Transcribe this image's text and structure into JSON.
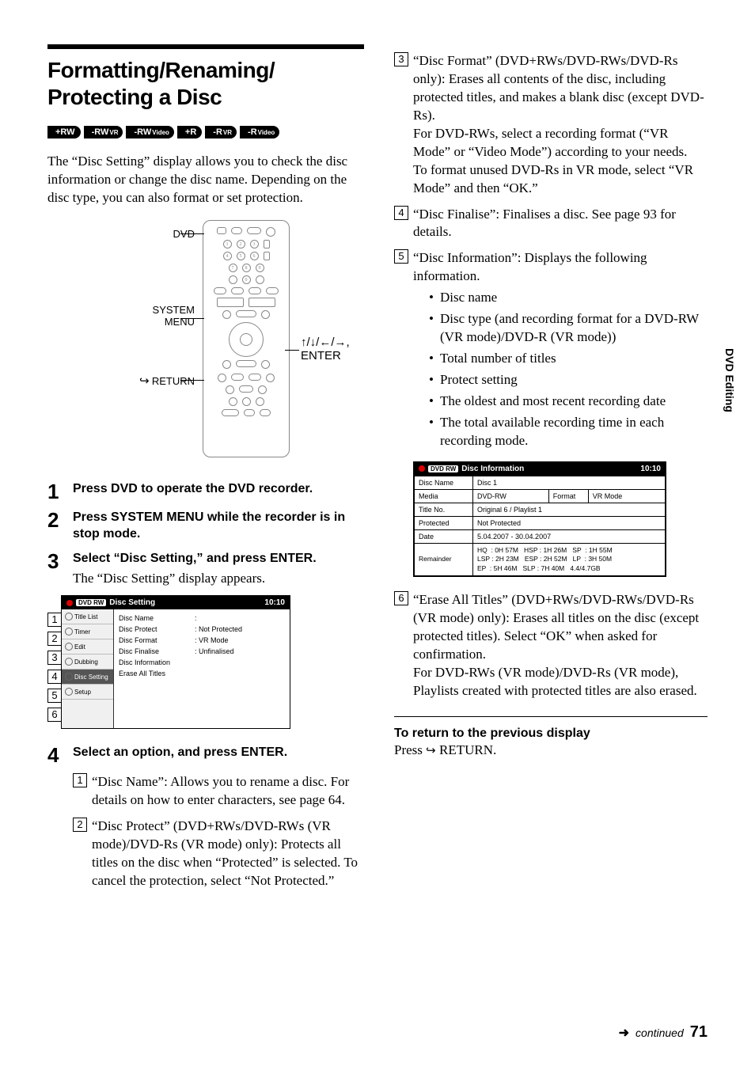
{
  "header": {
    "title_l1": "Formatting/Renaming/",
    "title_l2": "Protecting a Disc"
  },
  "disc_tags": [
    {
      "main": "+RW",
      "sub": ""
    },
    {
      "main": "-RW",
      "sub": "VR"
    },
    {
      "main": "-RW",
      "sub": "Video"
    },
    {
      "main": "+R",
      "sub": ""
    },
    {
      "main": "-R",
      "sub": "VR"
    },
    {
      "main": "-R",
      "sub": "Video"
    }
  ],
  "intro": "The “Disc Setting” display allows you to check the disc information or change the disc name. Depending on the disc type, you can also format or set protection.",
  "remote_labels": {
    "dvd": "DVD",
    "system_menu_l1": "SYSTEM",
    "system_menu_l2": "MENU",
    "return": "RETURN",
    "arrows_enter_l1": "↑/↓/←/→,",
    "arrows_enter_l2": "ENTER"
  },
  "steps": [
    {
      "n": "1",
      "bold": "Press DVD to operate the DVD recorder.",
      "plain": ""
    },
    {
      "n": "2",
      "bold": "Press SYSTEM MENU while the recorder is in stop mode.",
      "plain": ""
    },
    {
      "n": "3",
      "bold": "Select “Disc Setting,” and press ENTER.",
      "plain": "The “Disc Setting” display appears."
    },
    {
      "n": "4",
      "bold": "Select an option, and press ENTER.",
      "plain": ""
    }
  ],
  "disc_setting_ui": {
    "title": "Disc Setting",
    "clock": "10:10",
    "badge": "DVD RW",
    "side_tabs": [
      "Title List",
      "Timer",
      "Edit",
      "Dubbing",
      "Disc Setting",
      "Setup"
    ],
    "options": [
      {
        "name": "Disc Name",
        "value": ":"
      },
      {
        "name": "Disc Protect",
        "value": ": Not Protected"
      },
      {
        "name": "Disc Format",
        "value": ": VR Mode"
      },
      {
        "name": "Disc Finalise",
        "value": ": Unfinalised"
      },
      {
        "name": "Disc Information",
        "value": ""
      },
      {
        "name": "Erase All Titles",
        "value": ""
      }
    ]
  },
  "opts_left": [
    {
      "n": "1",
      "text": "“Disc Name”: Allows you to rename a disc. For details on how to enter characters, see page 64."
    },
    {
      "n": "2",
      "text": "“Disc Protect” (DVD+RWs/DVD-RWs (VR mode)/DVD-Rs (VR mode) only): Protects all titles on the disc when “Protected” is selected. To cancel the protection, select “Not Protected.”"
    }
  ],
  "opts_right": [
    {
      "n": "3",
      "text": "“Disc Format” (DVD+RWs/DVD-RWs/DVD-Rs only): Erases all contents of the disc, including protected titles, and makes a blank disc (except DVD-Rs).\nFor DVD-RWs, select a recording format (“VR Mode” or “Video Mode”) according to your needs.\nTo format unused DVD-Rs in VR mode, select “VR Mode” and then “OK.”"
    },
    {
      "n": "4",
      "text": "“Disc Finalise”: Finalises a disc. See page 93 for details."
    },
    {
      "n": "5",
      "text": "“Disc Information”: Displays the following information."
    }
  ],
  "info_bullets": [
    "Disc name",
    "Disc type (and recording format for a DVD-RW (VR mode)/DVD-R (VR mode))",
    "Total number of titles",
    "Protect setting",
    "The oldest and most recent recording date",
    "The total available recording time in each recording mode."
  ],
  "disc_info_ui": {
    "title": "Disc Information",
    "clock": "10:10",
    "badge": "DVD RW",
    "rows": {
      "disc_name_label": "Disc Name",
      "disc_name": "Disc 1",
      "media_label": "Media",
      "media": "DVD-RW",
      "format_label": "Format",
      "format": "VR Mode",
      "titleno_label": "Title No.",
      "titleno": "Original 6 / Playlist 1",
      "protected_label": "Protected",
      "protected": "Not Protected",
      "date_label": "Date",
      "date": "5.04.2007 - 30.04.2007",
      "remainder_label": "Remainder",
      "remainder": "HQ  : 0H 57M   HSP : 1H 26M   SP  : 1H 55M\nLSP : 2H 23M   ESP : 2H 52M   LP  : 3H 50M\nEP  : 5H 46M   SLP : 7H 40M   4.4/4.7GB"
    }
  },
  "opt6": {
    "n": "6",
    "text": "“Erase All Titles” (DVD+RWs/DVD-RWs/DVD-Rs (VR mode) only): Erases all titles on the disc (except protected titles). Select “OK” when asked for confirmation.\nFor DVD-RWs (VR mode)/DVD-Rs (VR mode), Playlists created with protected titles are also erased."
  },
  "return_section": {
    "head": "To return to the previous display",
    "text_pre": "Press ",
    "text_post": " RETURN."
  },
  "side_tab": "DVD Editing",
  "footer": {
    "continued": "continued",
    "page": "71"
  }
}
